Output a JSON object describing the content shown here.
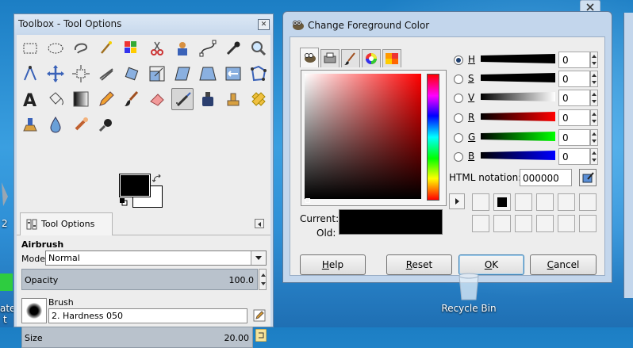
{
  "toolbox": {
    "title": "Toolbox - Tool Options",
    "tab_label": "Tool Options",
    "tool_name": "Airbrush",
    "mode_label": "Mode:",
    "mode_value": "Normal",
    "opacity_label": "Opacity",
    "opacity_value": "100.0",
    "brush_label": "Brush",
    "brush_value": "2. Hardness 050",
    "size_label": "Size",
    "size_value": "20.00",
    "fg_color": "#000000",
    "bg_color": "#ffffff"
  },
  "color_dialog": {
    "title": "Change Foreground Color",
    "channels": [
      {
        "key": "H",
        "value": "0",
        "selected": true
      },
      {
        "key": "S",
        "value": "0",
        "selected": false
      },
      {
        "key": "V",
        "value": "0",
        "selected": false
      },
      {
        "key": "R",
        "value": "0",
        "selected": false
      },
      {
        "key": "G",
        "value": "0",
        "selected": false
      },
      {
        "key": "B",
        "value": "0",
        "selected": false
      }
    ],
    "html_label": "HTML notation:",
    "html_value": "000000",
    "current_label": "Current:",
    "old_label": "Old:",
    "current_color": "#000000",
    "buttons": {
      "help": "Help",
      "reset": "Reset",
      "ok": "OK",
      "cancel": "Cancel"
    }
  },
  "desktop": {
    "recycle_label": "Recycle Bin",
    "left_fragments": [
      "2",
      "ate",
      "t"
    ]
  }
}
